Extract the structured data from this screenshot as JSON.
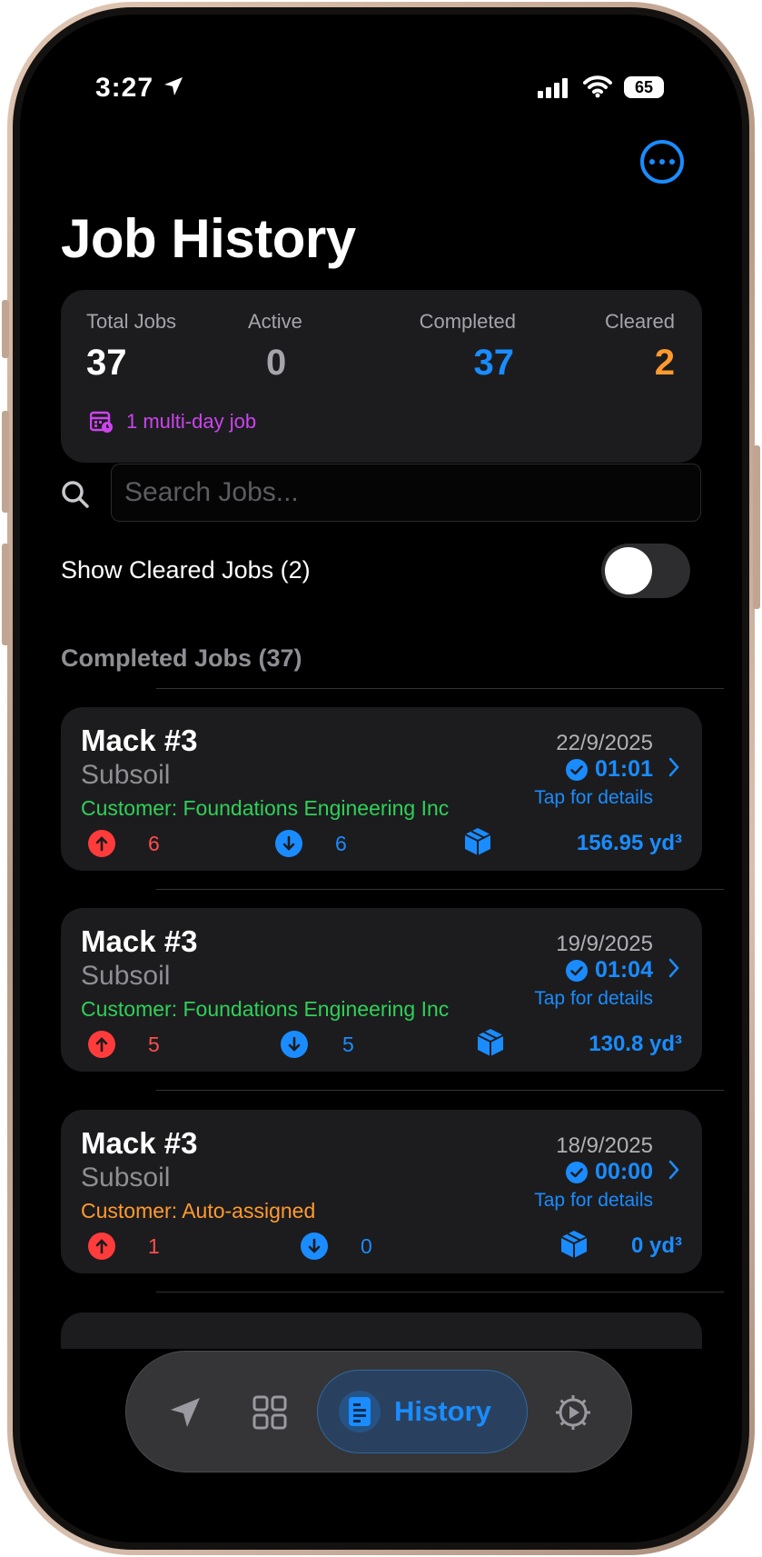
{
  "status": {
    "time": "3:27",
    "battery": "65"
  },
  "page": {
    "title": "Job History",
    "more_icon": "ellipsis-circle-icon"
  },
  "stats": [
    {
      "label": "Total Jobs",
      "value": "37",
      "color": "#ffffff"
    },
    {
      "label": "Active",
      "value": "0",
      "color": "#a4a4aa"
    },
    {
      "label": "Completed",
      "value": "37",
      "color": "#1a8cff"
    },
    {
      "label": "Cleared",
      "value": "2",
      "color": "#ff9a2e"
    }
  ],
  "multi_day": {
    "label": "1 multi-day job",
    "color": "#cc44ee"
  },
  "search": {
    "placeholder": "Search Jobs..."
  },
  "show_cleared": {
    "label": "Show Cleared Jobs (2)",
    "on": false
  },
  "section": {
    "title": "Completed Jobs (37)"
  },
  "jobs": [
    {
      "title": "Mack #3",
      "material": "Subsoil",
      "customer": "Customer: Foundations Engineering Inc",
      "customer_color": "#2fd158",
      "date": "22/9/2025",
      "duration": "01:01",
      "tap": "Tap for details",
      "up": "6",
      "down": "6",
      "volume": "156.95 yd³"
    },
    {
      "title": "Mack #3",
      "material": "Subsoil",
      "customer": "Customer: Foundations Engineering Inc",
      "customer_color": "#2fd158",
      "date": "19/9/2025",
      "duration": "01:04",
      "tap": "Tap for details",
      "up": "5",
      "down": "5",
      "volume": "130.8 yd³"
    },
    {
      "title": "Mack #3",
      "material": "Subsoil",
      "customer": "Customer: Auto-assigned",
      "customer_color": "#ff9a2e",
      "date": "18/9/2025",
      "duration": "00:00",
      "tap": "Tap for details",
      "up": "1",
      "down": "0",
      "volume": "0 yd³"
    }
  ],
  "tabbar": {
    "items": [
      {
        "name": "location-arrow-icon"
      },
      {
        "name": "grid-icon"
      },
      {
        "name": "history-icon",
        "label": "History",
        "active": true
      },
      {
        "name": "settings-gear-icon"
      }
    ]
  },
  "colors": {
    "accent": "#1a8cff",
    "up": "#ff3b3b",
    "down": "#1a8cff"
  }
}
